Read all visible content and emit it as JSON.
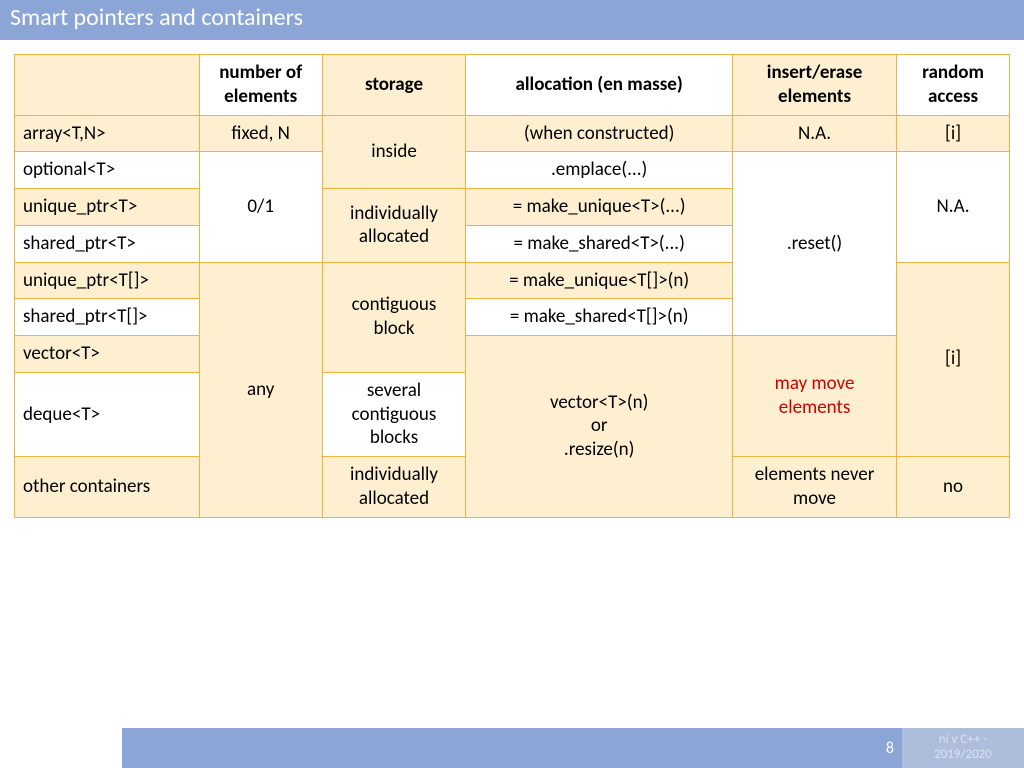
{
  "title": "Smart pointers and containers",
  "footer": {
    "page": "8",
    "note_line1": "ní v C++ -",
    "note_line2": "2019/2020"
  },
  "headers": {
    "num": "number of elements",
    "storage": "storage",
    "alloc": "allocation (en masse)",
    "insert": "insert/erase elements",
    "random": "random access"
  },
  "rows": {
    "array": "array<T,N>",
    "optional": "optional<T>",
    "unique": "unique_ptr<T>",
    "shared": "shared_ptr<T>",
    "unique_arr": "unique_ptr<T[]>",
    "shared_arr": "shared_ptr<T[]>",
    "vector": "vector<T>",
    "deque": "deque<T>",
    "other": "other containers"
  },
  "cells": {
    "fixedN": "fixed, N",
    "inside": "inside",
    "constructed": "(when constructed)",
    "na": "N.A.",
    "idx": "[i]",
    "zero1": "0/1",
    "emplace": ".emplace(...)",
    "indiv_alloc": "individually allocated",
    "make_unique": "= make_unique<T>(...)",
    "reset": ".reset()",
    "make_shared": "= make_shared<T>(...)",
    "contig": "contiguous block",
    "make_unique_arr": "= make_unique<T[]>(n)",
    "make_shared_arr": "= make_shared<T[]>(n)",
    "any": "any",
    "vector_resize": "vector<T>(n)\nor\n.resize(n)",
    "may_move": "may move elements",
    "several": "several contiguous blocks",
    "never_move": "elements never move",
    "no": "no"
  }
}
